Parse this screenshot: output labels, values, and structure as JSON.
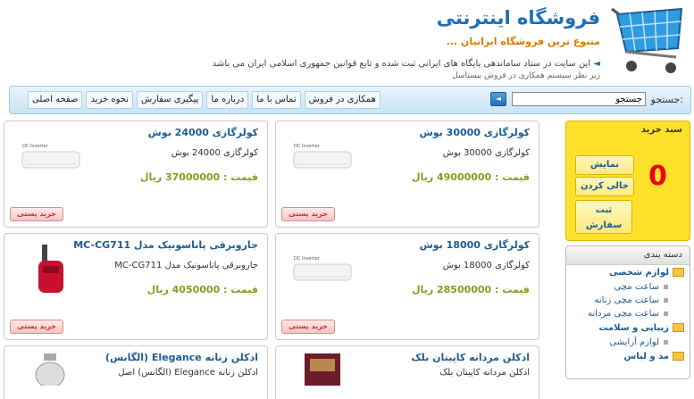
{
  "header": {
    "site_title": "فروشگاه اینترنتی",
    "site_subtitle": "متنوع ترین فروشگاه ایرانیان ...",
    "notice_line1": "این سایت در ستاد ساماندهی پایگاه های ایرانی ثبت شده و تابع قوانین جمهوری اسلامی ایران می باشد",
    "notice_line2": "زیر نظر سیستم همکاری در فروش بیستاسل"
  },
  "search": {
    "label": "جستجو:",
    "value": "جستجو"
  },
  "nav": {
    "items": [
      "همکاری در فروش",
      "تماس با ما",
      "درباره ما",
      "پیگیری سفارش",
      "نحوه خرید",
      "صفحه اصلی"
    ]
  },
  "products": [
    {
      "title": "کولرگازی 24000 بوش",
      "desc": "کولرگازی 24000 بوش",
      "price": "قیمت : 37000000 ریال",
      "buy": "خرید پستی",
      "img": "air-conditioner",
      "brand": "DC Inverter"
    },
    {
      "title": "کولرگازی 30000 بوش",
      "desc": "کولرگازی 30000 بوش",
      "price": "قیمت : 49000000 ریال",
      "buy": "خرید پستی",
      "img": "air-conditioner",
      "brand": "DC Inverter"
    },
    {
      "title": "جاروبرقی پاناسونیک مدل MC-CG711",
      "desc": "جاروبرقی پاناسونیک مدل MC-CG711",
      "price": "قیمت : 4050000 ریال",
      "buy": "خرید پستی",
      "img": "vacuum-cleaner",
      "brand": ""
    },
    {
      "title": "کولرگازی 18000 بوش",
      "desc": "کولرگازی 18000 بوش",
      "price": "قیمت : 28500000 ریال",
      "buy": "خرید پستی",
      "img": "air-conditioner",
      "brand": "DC Inverter"
    },
    {
      "title": "ادکلن زنانه Elegance (الگانس)",
      "desc": "ادکلن زنانه Elegance (الگانس) اصل",
      "price": "",
      "buy": "",
      "img": "perfume",
      "brand": ""
    },
    {
      "title": "ادکلن مردانه کاپیتان بلک",
      "desc": "ادکلن مردانه کاپیتان بلک",
      "price": "",
      "buy": "",
      "img": "perfume",
      "brand": ""
    }
  ],
  "cart": {
    "title": "سبد خرید",
    "count": "0",
    "show": "نمایش",
    "empty": "خالی کردن",
    "order_line1": "ثبت",
    "order_line2": "سفارش"
  },
  "categories": {
    "title": "دسته بندی",
    "items": [
      {
        "label": "لوازم شخصی",
        "level": "top"
      },
      {
        "label": "ساعت مچی",
        "level": "sub"
      },
      {
        "label": "ساعت مچی زنانه",
        "level": "sub"
      },
      {
        "label": "ساعت مچی مردانه",
        "level": "sub"
      },
      {
        "label": "زیبایی و سلامت",
        "level": "top"
      },
      {
        "label": "لوازم آرایشی",
        "level": "sub"
      },
      {
        "label": "مد و لباس",
        "level": "top"
      }
    ]
  },
  "colors": {
    "accent": "#1d6fb8",
    "price": "#8a9a1f",
    "cart_bg": "#ffe12b",
    "nav_bg": "#c8e4f4"
  }
}
